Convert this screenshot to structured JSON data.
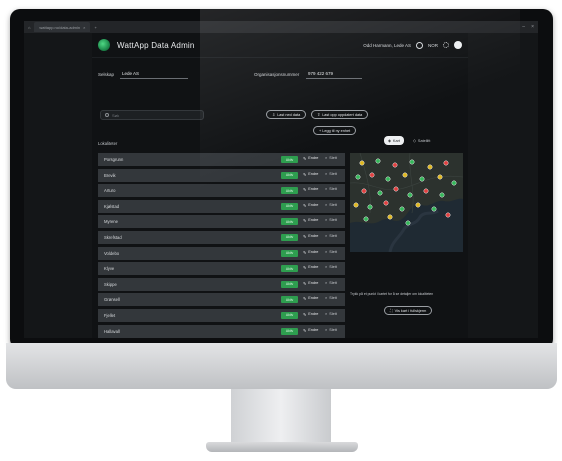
{
  "browser": {
    "tab_label": "wattapp.no/data-admin"
  },
  "header": {
    "app_name": "WattApp Data Admin",
    "user_label": "Odd Harmann, Lede AS",
    "language": "NOR"
  },
  "fields": {
    "company_label": "Selskap",
    "company_value": "Lede AS",
    "orgnr_label": "Organisasjonsnummer",
    "orgnr_value": "979 422 679"
  },
  "toolbar": {
    "search_placeholder": "Søk",
    "upload_label": "Last ned data",
    "upload_all_label": "Last opp oppdatert data",
    "add_label": "+ Legg til ny enhet"
  },
  "list": {
    "header": "Lokaliteter",
    "status_label": "Aktiv",
    "edit_label": "Endre",
    "delete_label": "Slett",
    "rows": [
      {
        "name": "Porsgrunn"
      },
      {
        "name": "Brevik"
      },
      {
        "name": "Arturo"
      },
      {
        "name": "Kjølstad"
      },
      {
        "name": "Myrene"
      },
      {
        "name": "Skrefstad"
      },
      {
        "name": "Voldebo"
      },
      {
        "name": "Klyve"
      },
      {
        "name": "Skippe"
      },
      {
        "name": "Grønsell"
      },
      {
        "name": "Fjellet"
      },
      {
        "name": "Hallavall"
      }
    ]
  },
  "map": {
    "view_map_label": "Kart",
    "view_satellite_label": "Satellitt",
    "hint": "Trykk på et punkt i kartet for å se detaljer om lokaliteten",
    "fullscreen_label": "Vis kart i fullskjerm",
    "colors": {
      "active": "#35b85a",
      "warning": "#e0b81e",
      "error": "#e04040"
    }
  }
}
